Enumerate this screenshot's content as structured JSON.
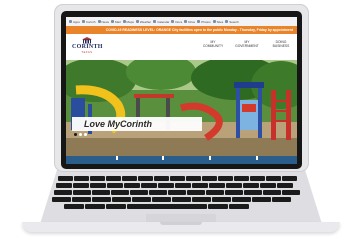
{
  "browser": {
    "bookmarks": [
      "Apps",
      "Corinth",
      "News",
      "Mail",
      "Maps",
      "Weather",
      "Calendar",
      "Docs",
      "Drive",
      "Photos",
      "Sites",
      "Search"
    ]
  },
  "alert": {
    "text": "COVID-19 READINESS LEVEL: ORANGE City facilities open to the public Monday - Thursday, Friday by appointment"
  },
  "header": {
    "logo_text": "CORINTH",
    "logo_sub": "TEXAS",
    "nav": [
      {
        "line1": "MY",
        "line2": "COMMUNITY"
      },
      {
        "line1": "MY",
        "line2": "GOVERNMENT"
      },
      {
        "line1": "DOING",
        "line2": "BUSINESS"
      }
    ]
  },
  "hero": {
    "tagline": "Love MyCorinth",
    "slide_count": 3,
    "active_slide": 1
  },
  "colors": {
    "alert_bg": "#e9842b",
    "logo_navy": "#1f2a5a",
    "footer_blue": "#2a5d8a"
  }
}
